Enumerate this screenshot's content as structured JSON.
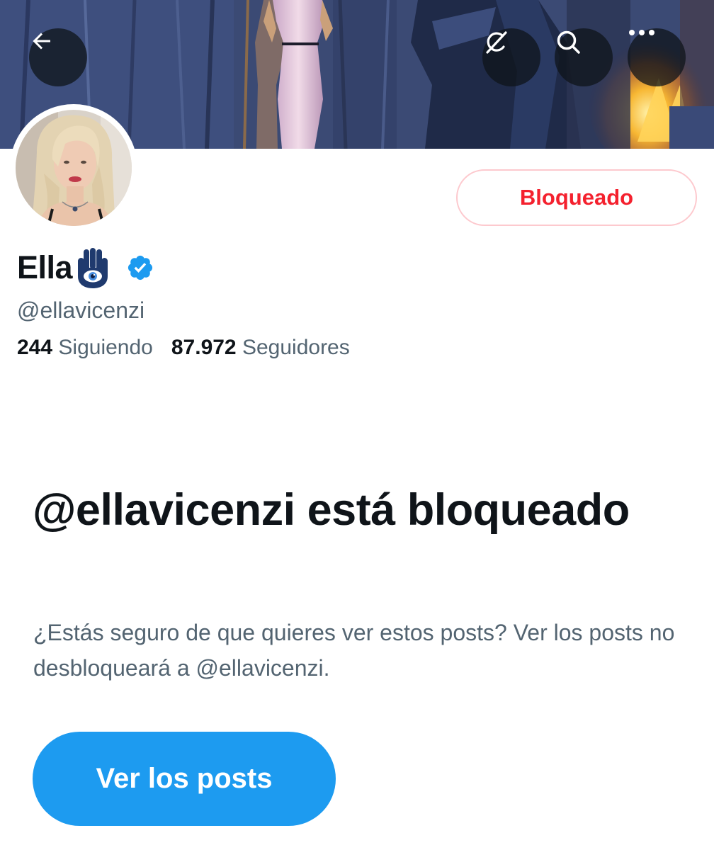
{
  "header": {
    "back_icon": "arrow-left-icon",
    "grok_icon": "grok-icon",
    "search_icon": "search-icon",
    "more_icon": "ellipsis-icon"
  },
  "profile": {
    "display_name": "Ella",
    "name_emoji_icon": "hamsa-icon",
    "verified_icon": "verified-badge-icon",
    "verified_color": "#1d9bf0",
    "handle": "@ellavicenzi",
    "following_count": "244",
    "following_label": "Siguiendo",
    "followers_count": "87.972",
    "followers_label": "Seguidores",
    "blocked_button_label": "Bloqueado",
    "blocked_button_color": "#f4212e"
  },
  "notice": {
    "title": "@ellavicenzi está bloqueado",
    "description": "¿Estás seguro de que quieres ver estos posts? Ver los posts no desbloqueará a @ellavicenzi.",
    "view_button_label": "Ver los posts",
    "view_button_color": "#1d9bf0"
  }
}
